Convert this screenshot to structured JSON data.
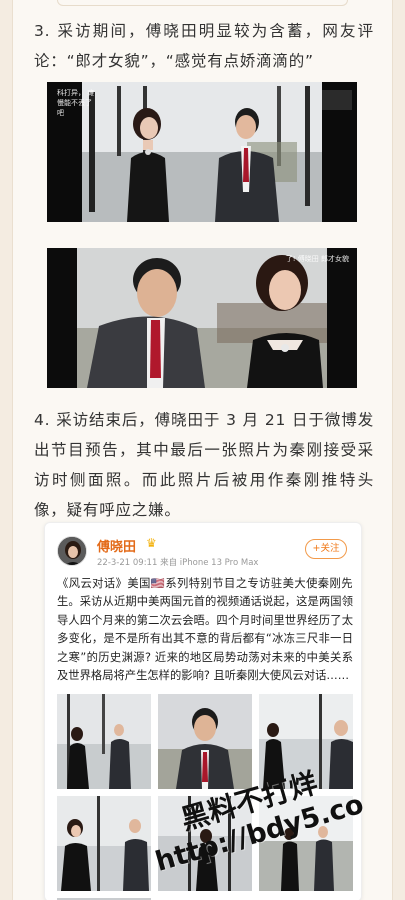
{
  "article": {
    "para3": "3. 采访期间，傅晓田明显较为含蓄，网友评论：“郎才女貌”，“感觉有点娇滴滴的”",
    "photo1_overlay_left": "科打异， 瘫慢能不丢了吧",
    "photo2_overlay_right": "了! 傅晓田 郎才女貌",
    "para4": "4. 采访结束后，傅晓田于 3 月 21 日于微博发出节目预告，其中最后一张照片为秦刚接受采访时侧面照。而此照片后被用作秦刚推特头像，疑有呼应之嫌。"
  },
  "weibo_post": {
    "username": "傅晓田",
    "verified_icon": "crown-icon",
    "meta": "22-3-21 09:11  来自 iPhone 13 Pro Max",
    "follow_label": "+关注",
    "text": "《风云对话》美国🇺🇸系列特别节目之专访驻美大使秦刚先生。采访从近期中美两国元首的视频通话说起，这是两国领导人四个月来的第二次云会晤。四个月时间里世界经历了太多变化，是不是所有出其不意的背后都有“冰冻三尺非一日之寒”的历史渊源? 近来的地区局势动荡对未来的中美关系及世界格局将产生怎样的影响? 且听秦刚大使风云对话……",
    "image_count": 9
  },
  "watermark": {
    "line1": "黑料不打烊",
    "line2": "http://bdy5.co"
  },
  "colors": {
    "page_bg": "#f4ece1",
    "card_bg": "#fbf8f3",
    "username": "#e36b1a",
    "follow_border": "#f29a4a"
  }
}
